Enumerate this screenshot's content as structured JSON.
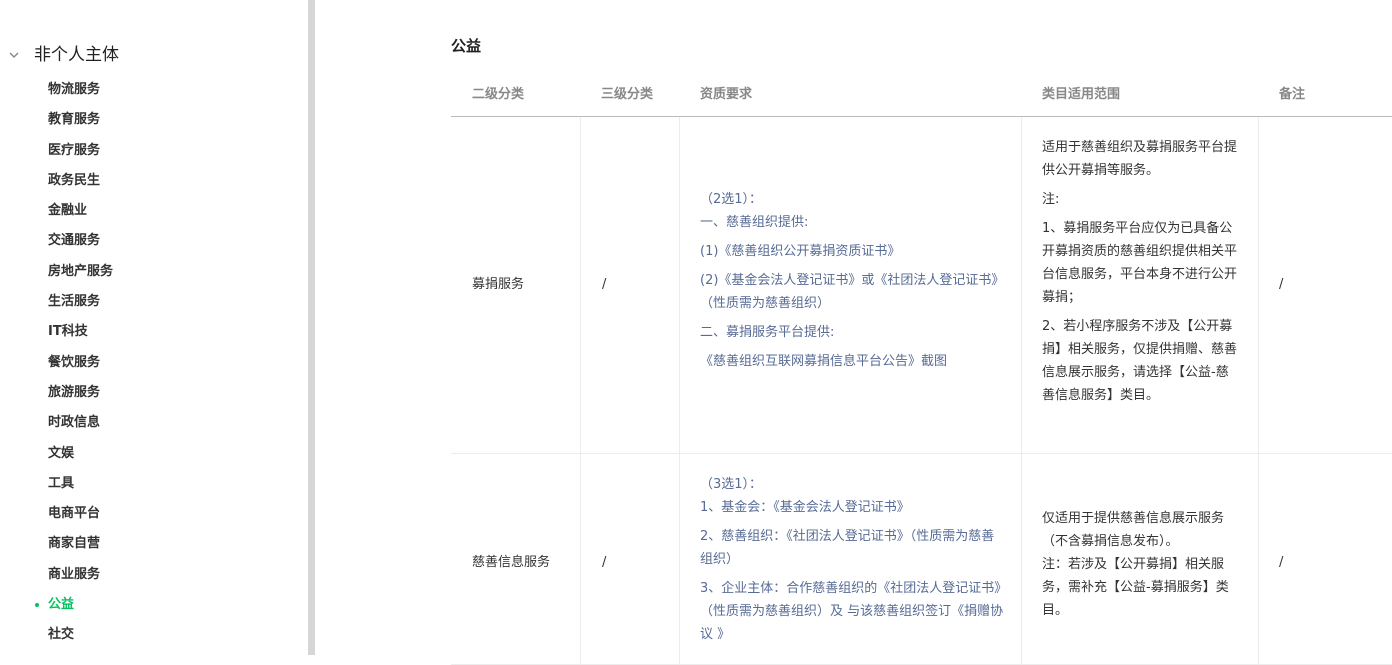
{
  "sidebar": {
    "group_title": "非个人主体",
    "items": [
      {
        "label": "物流服务",
        "active": false
      },
      {
        "label": "教育服务",
        "active": false
      },
      {
        "label": "医疗服务",
        "active": false
      },
      {
        "label": "政务民生",
        "active": false
      },
      {
        "label": "金融业",
        "active": false
      },
      {
        "label": "交通服务",
        "active": false
      },
      {
        "label": "房地产服务",
        "active": false
      },
      {
        "label": "生活服务",
        "active": false
      },
      {
        "label": "IT科技",
        "active": false
      },
      {
        "label": "餐饮服务",
        "active": false
      },
      {
        "label": "旅游服务",
        "active": false
      },
      {
        "label": "时政信息",
        "active": false
      },
      {
        "label": "文娱",
        "active": false
      },
      {
        "label": "工具",
        "active": false
      },
      {
        "label": "电商平台",
        "active": false
      },
      {
        "label": "商家自营",
        "active": false
      },
      {
        "label": "商业服务",
        "active": false
      },
      {
        "label": "公益",
        "active": true
      },
      {
        "label": "社交",
        "active": false
      }
    ]
  },
  "section": {
    "title": "公益"
  },
  "table": {
    "headers": [
      "二级分类",
      "三级分类",
      "资质要求",
      "类目适用范围",
      "备注"
    ],
    "rows": [
      {
        "level2": "募捐服务",
        "level3": "/",
        "qualification": [
          "（2选1）：",
          "一、慈善组织提供:",
          "(1)《慈善组织公开募捐资质证书》",
          "(2)《基金会法人登记证书》或《社团法人登记证书》（性质需为慈善组织）",
          "二、募捐服务平台提供:",
          "《慈善组织互联网募捐信息平台公告》截图"
        ],
        "scope": [
          "适用于慈善组织及募捐服务平台提供公开募捐等服务。",
          "注:",
          "1、募捐服务平台应仅为已具备公开募捐资质的慈善组织提供相关平台信息服务，平台本身不进行公开募捐；",
          "2、若小程序服务不涉及【公开募捐】相关服务，仅提供捐赠、慈善信息展示服务，请选择【公益-慈善信息服务】类目。"
        ],
        "note": "/"
      },
      {
        "level2": "慈善信息服务",
        "level3": "/",
        "qualification": [
          "（3选1）：",
          "1、基金会：《基金会法人登记证书》",
          "2、慈善组织：《社团法人登记证书》（性质需为慈善组织）",
          "3、企业主体：合作慈善组织的《社团法人登记证书》（性质需为慈善组织）及 与该慈善组织签订《捐赠协议 》"
        ],
        "scope": [
          "仅适用于提供慈善信息展示服务（不含募捐信息发布）。",
          "注：若涉及【公开募捐】相关服务，需补充【公益-募捐服务】类目。"
        ],
        "note": "/"
      }
    ]
  },
  "colors": {
    "accent": "#07c160",
    "link": "#576b95"
  }
}
